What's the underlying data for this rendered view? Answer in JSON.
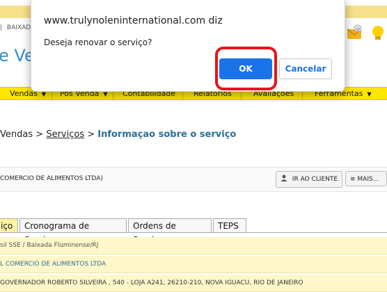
{
  "header": {
    "small_links": [
      "|",
      "BAIXADA"
    ],
    "title_fragment": "e Ven",
    "icons": [
      "mail-icon",
      "lightbulb-icon"
    ]
  },
  "nav": {
    "items": [
      {
        "label": "Vendas",
        "caret": "▼"
      },
      {
        "label": "Pós Venda",
        "caret": "▼"
      },
      {
        "label": "Contabilidade",
        "caret": ""
      },
      {
        "label": "Relatórios",
        "caret": ""
      },
      {
        "label": "Avaliações",
        "caret": ""
      },
      {
        "label": "Ferramentas",
        "caret": "▼"
      }
    ]
  },
  "breadcrumb": {
    "part1": "Vendas",
    "sep": ">",
    "part2": "Serviços",
    "current": "Informaçao sobre o serviço"
  },
  "client": {
    "name": "COMERCIO DE ALIMENTOS LTDA)",
    "btn_cliente": "IR AO CLIENTE",
    "btn_mais": "MAIS..."
  },
  "tabs": [
    {
      "label": "iço",
      "active": true
    },
    {
      "label": "Cronograma de Serviços",
      "active": false
    },
    {
      "label": "Ordens de Serviço",
      "active": false
    },
    {
      "label": "TEPS",
      "active": false
    }
  ],
  "info": {
    "row1": "sil SSE / Baixada Fluminense/RJ",
    "row2": "L COMERCIO DE ALIMENTOS LTDA",
    "row3": "GOVERNADOR ROBERTO SILVEIRA , 540 - LOJA A241, 26210-210, NOVA IGUACU, RIO DE JANEIRO"
  },
  "dialog": {
    "origin": "www.trulynoleninternational.com diz",
    "message": "Deseja renovar o serviço?",
    "ok_label": "OK",
    "cancel_label": "Cancelar"
  },
  "colors": {
    "nav_bg": "#ffe600",
    "ok_bg": "#1a73e8",
    "highlight": "#e8141b",
    "row_bg": "#fff7c9"
  }
}
